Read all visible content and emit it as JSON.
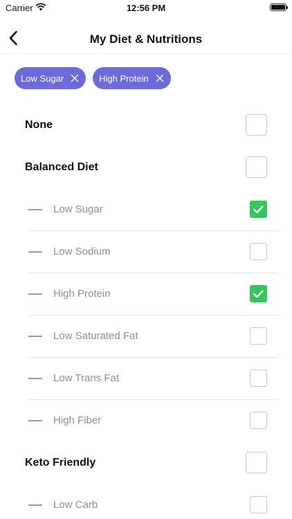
{
  "status_bar": {
    "carrier": "Carrier",
    "time": "12:56 PM"
  },
  "nav": {
    "title": "My Diet & Nutritions",
    "back_icon": "chevron-left-icon"
  },
  "selected_chips": [
    {
      "label": "Low Sugar"
    },
    {
      "label": "High Protein"
    }
  ],
  "categories": [
    {
      "label": "None",
      "checked": false
    },
    {
      "label": "Balanced Diet",
      "checked": false
    },
    {
      "label": "Keto Friendly",
      "checked": false
    }
  ],
  "balanced_items": [
    {
      "label": "Low Sugar",
      "checked": true
    },
    {
      "label": "Low Sodium",
      "checked": false
    },
    {
      "label": "High Protein",
      "checked": true
    },
    {
      "label": "Low Saturated Fat",
      "checked": false
    },
    {
      "label": "Low Trans Fat",
      "checked": false
    },
    {
      "label": "High Fiber",
      "checked": false
    }
  ],
  "keto_items": [
    {
      "label": "Low Carb",
      "checked": false
    }
  ],
  "colors": {
    "chip": "#6c6bd9",
    "checked": "#34c759"
  }
}
